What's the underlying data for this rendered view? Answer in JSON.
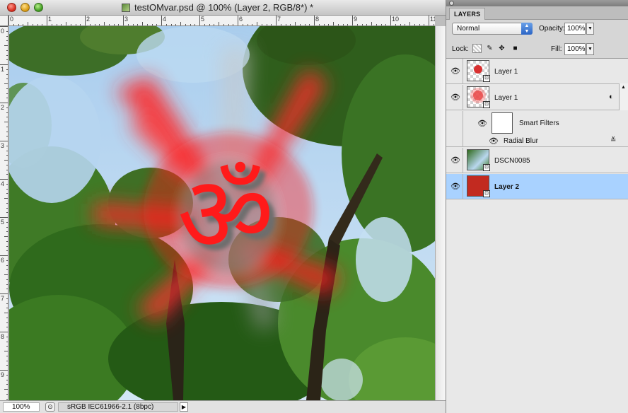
{
  "document": {
    "title": "testOMvar.psd @ 100% (Layer 2, RGB/8*) *",
    "ruler_top_labels": [
      "0",
      "1",
      "2",
      "3",
      "4",
      "5",
      "6",
      "7",
      "8",
      "9",
      "10",
      "11"
    ],
    "ruler_left_labels": [
      "0",
      "1",
      "2",
      "3",
      "4",
      "5",
      "6",
      "7",
      "8",
      "9"
    ],
    "status": {
      "zoom": "100%",
      "profile": "sRGB IEC61966-2.1 (8bpc)",
      "arrow": "▶"
    },
    "artwork": {
      "glyph": "ॐ",
      "glyph_color": "#ff1a1a",
      "sky_color": "#b9d7ef",
      "foliage_color": "#2f6a1c"
    }
  },
  "panel": {
    "tab_label": "LAYERS",
    "menu_glyph": "≡",
    "blend_mode": "Normal",
    "opacity_label": "Opacity:",
    "opacity_value": "100%",
    "lock_label": "Lock:",
    "fill_label": "Fill:",
    "fill_value": "100%",
    "layers": [
      {
        "name": "Layer 1",
        "visible": true,
        "selected": false
      },
      {
        "name": "Layer 1",
        "visible": true,
        "selected": false,
        "smart_object": true
      },
      {
        "name": "Smart Filters",
        "visible": true,
        "selected": false,
        "kind": "smart-filters"
      },
      {
        "name": "Radial Blur",
        "visible": true,
        "selected": false,
        "kind": "filter"
      },
      {
        "name": "DSCN0085",
        "visible": true,
        "selected": false
      },
      {
        "name": "Layer 2",
        "visible": true,
        "selected": true,
        "fill_color": "#c22a20"
      }
    ],
    "accent_color": "#a9d2ff"
  }
}
